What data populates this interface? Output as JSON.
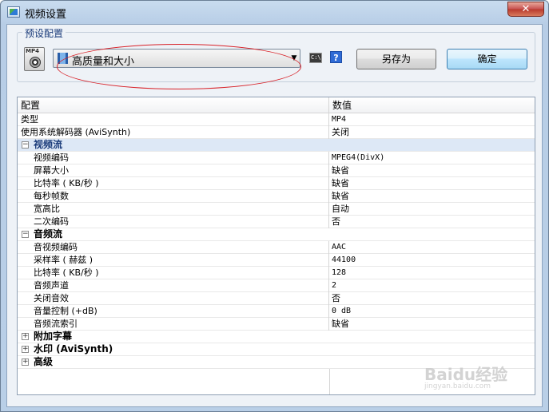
{
  "window": {
    "title": "视频设置",
    "close_label": "✕"
  },
  "preset": {
    "group_label": "预设配置",
    "icon_label": "MP4",
    "selected": "高质量和大小",
    "saveas_label": "另存为",
    "ok_label": "确定"
  },
  "grid": {
    "columns": [
      "配置",
      "数值"
    ],
    "rows": [
      {
        "kind": "top",
        "key": "类型",
        "value": "MP4",
        "mono": true
      },
      {
        "kind": "top",
        "key": "使用系统解码器 (AviSynth)",
        "value": "关闭"
      },
      {
        "kind": "group",
        "key": "视频流",
        "expanded": true,
        "selected": true
      },
      {
        "kind": "child",
        "key": "视频编码",
        "value": "MPEG4(DivX)",
        "mono": true
      },
      {
        "kind": "child",
        "key": "屏幕大小",
        "value": "缺省"
      },
      {
        "kind": "child",
        "key": "比特率 ( KB/秒 )",
        "value": "缺省"
      },
      {
        "kind": "child",
        "key": "每秒帧数",
        "value": "缺省"
      },
      {
        "kind": "child",
        "key": "宽高比",
        "value": "自动"
      },
      {
        "kind": "child",
        "key": "二次编码",
        "value": "否"
      },
      {
        "kind": "group",
        "key": "音频流",
        "expanded": true
      },
      {
        "kind": "child",
        "key": "音视频编码",
        "value": "AAC",
        "mono": true
      },
      {
        "kind": "child",
        "key": "采样率 ( 赫兹 )",
        "value": "44100",
        "mono": true
      },
      {
        "kind": "child",
        "key": "比特率 ( KB/秒 )",
        "value": "128",
        "mono": true
      },
      {
        "kind": "child",
        "key": "音频声道",
        "value": "2",
        "mono": true
      },
      {
        "kind": "child",
        "key": "关闭音效",
        "value": "否"
      },
      {
        "kind": "child",
        "key": "音量控制 (+dB)",
        "value": "0 dB",
        "mono": true
      },
      {
        "kind": "child",
        "key": "音频流索引",
        "value": "缺省"
      },
      {
        "kind": "group",
        "key": "附加字幕",
        "expanded": false
      },
      {
        "kind": "group",
        "key": "水印 (AviSynth)",
        "expanded": false
      },
      {
        "kind": "group",
        "key": "高级",
        "expanded": false
      }
    ]
  },
  "watermark": {
    "text": "Baidu经验",
    "sub": "jingyan.baidu.com"
  }
}
